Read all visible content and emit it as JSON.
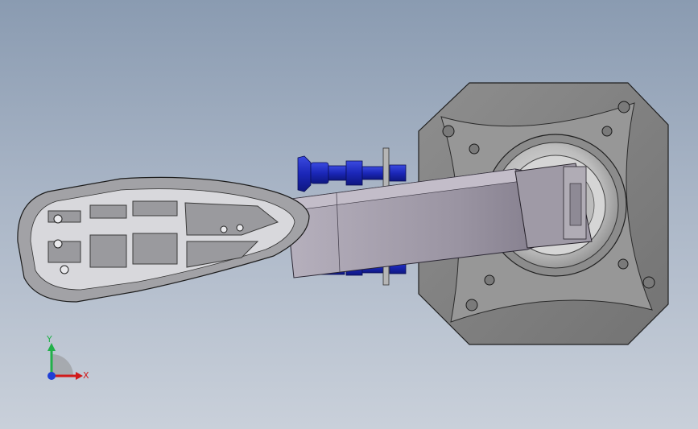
{
  "view": {
    "background_top": "#8a9bb1",
    "background_bottom": "#c9d0da"
  },
  "triad": {
    "x_label": "X",
    "y_label": "Y",
    "x_color": "#d11a1a",
    "y_color": "#22b04a",
    "z_color": "#1f3fd6"
  },
  "colors": {
    "base_plate": "#7c7c7c",
    "base_face": "#8b8b8b",
    "arm_body": "#a8a2b0",
    "arm_light": "#c9c4cf",
    "gripper_frame": "#a4a4a8",
    "actuator_blue": "#1f2fc8"
  }
}
